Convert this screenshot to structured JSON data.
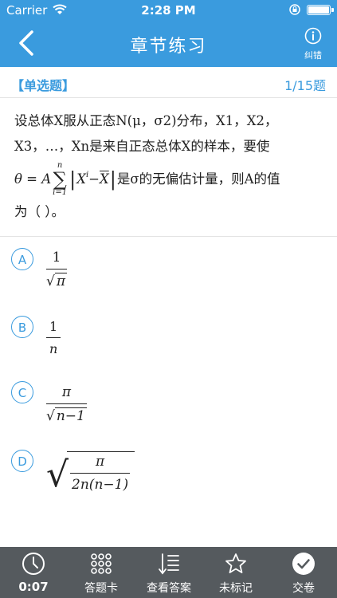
{
  "status_bar": {
    "carrier": "Carrier",
    "time": "2:28 PM"
  },
  "nav": {
    "title": "章节练习",
    "report_label": "纠错"
  },
  "question": {
    "type": "【单选题】",
    "counter": "1/15题",
    "text_line1": "设总体X服从正态N(μ，σ2)分布，X1，X2，",
    "text_line2": "X3，…，Xn是来自正态总体X的样本，要使",
    "formula_lhs": "θ = A",
    "sum_top": "n",
    "sum_bottom": "i=1",
    "formula_abs": "X",
    "formula_sub": "i",
    "formula_minus": " − ",
    "formula_xbar": "X",
    "text_after_formula": "是σ的无偏估计量，则A的值",
    "text_line4": "为（    ）。"
  },
  "options": [
    {
      "letter": "A",
      "num": "1",
      "den": "π"
    },
    {
      "letter": "B",
      "num": "1",
      "den": "n"
    },
    {
      "letter": "C",
      "num": "π",
      "den": "n−1"
    },
    {
      "letter": "D",
      "num": "π",
      "den": "2n(n−1)"
    }
  ],
  "tabbar": {
    "timer": "0:07",
    "card": "答题卡",
    "answer": "查看答案",
    "mark": "未标记",
    "submit": "交卷"
  }
}
